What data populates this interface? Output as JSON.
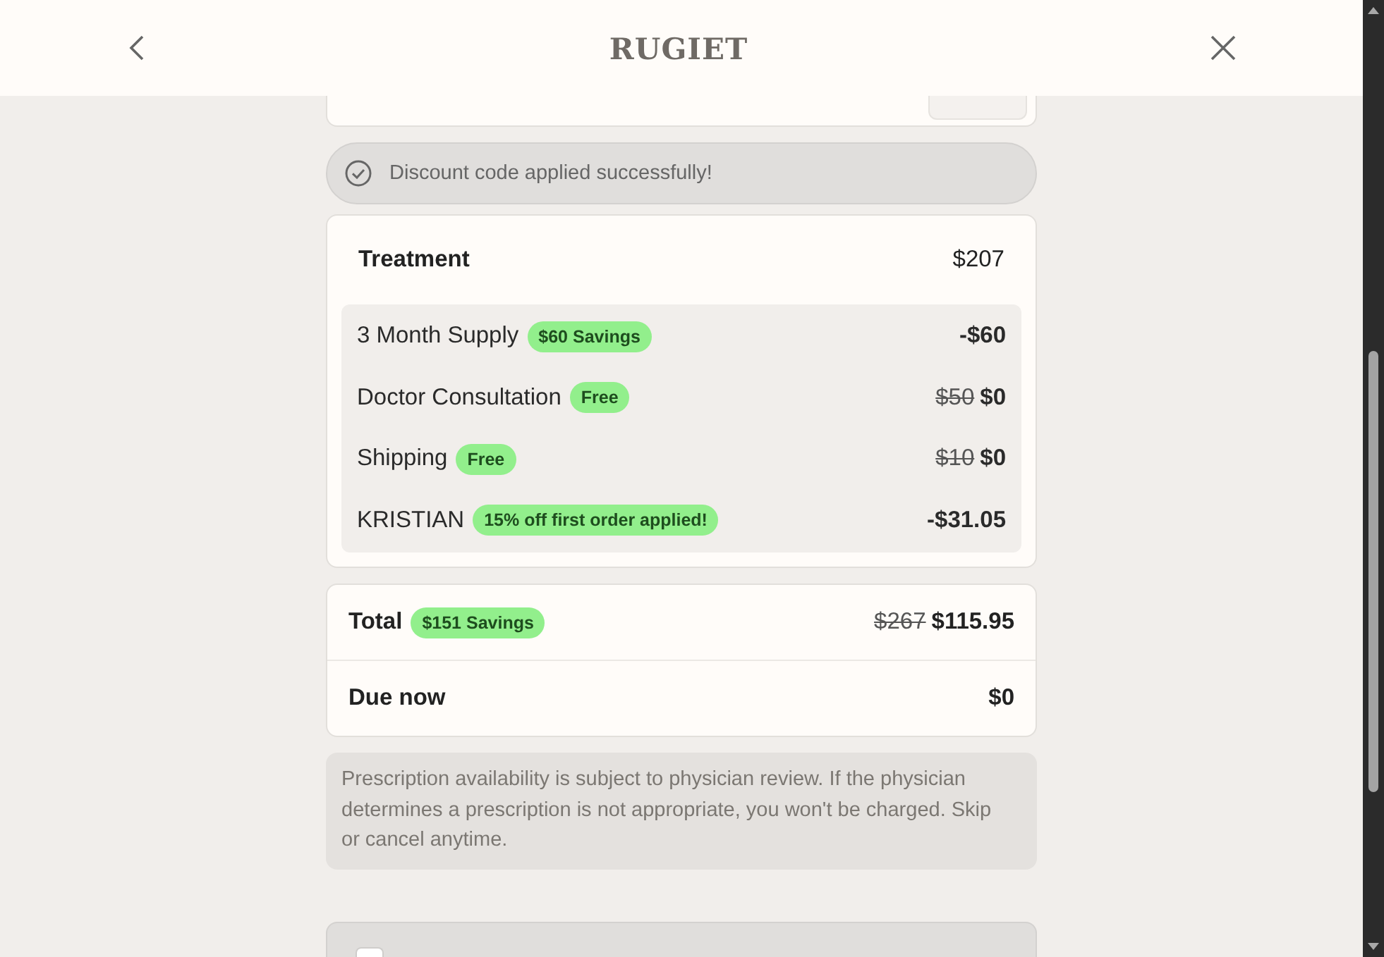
{
  "header": {
    "brand": "RUGIET"
  },
  "promo": {
    "kind": "field"
  },
  "banner": {
    "message": "Discount code applied successfully!"
  },
  "treatment": {
    "label": "Treatment",
    "price": "$207",
    "items": [
      {
        "label": "3 Month Supply",
        "badge": "$60 Savings",
        "price": "-$60"
      },
      {
        "label": "Doctor Consultation",
        "badge": "Free",
        "original_price": "$50",
        "price": "$0"
      },
      {
        "label": "Shipping",
        "badge": "Free",
        "original_price": "$10",
        "price": "$0"
      },
      {
        "label": "KRISTIAN",
        "badge": "15% off first order applied!",
        "price": "-$31.05"
      }
    ]
  },
  "summary": {
    "total": {
      "label": "Total",
      "badge": "$151 Savings",
      "original_price": "$267",
      "price": "$115.95"
    },
    "due_now": {
      "label": "Due now",
      "price": "$0"
    }
  },
  "notice": "Prescription availability is subject to physician review. If the physician determines a prescription is not appropriate, you won't be charged. Skip or cancel anytime.",
  "terms": {
    "checked": false
  }
}
